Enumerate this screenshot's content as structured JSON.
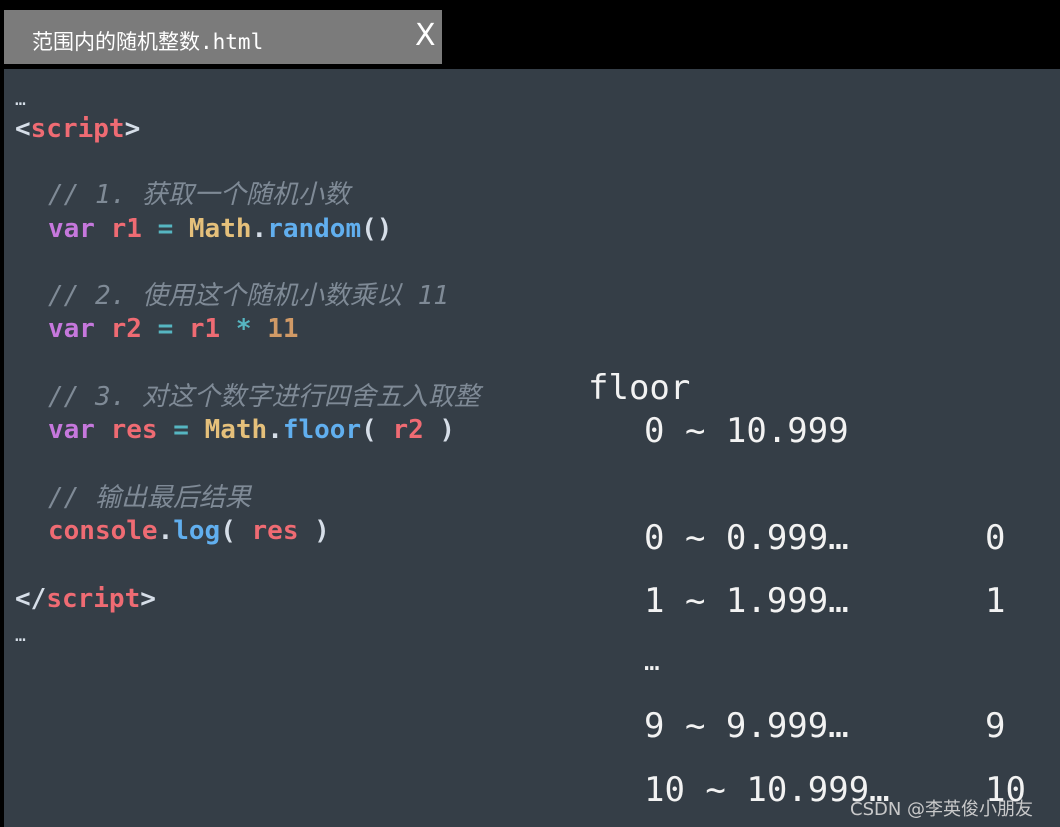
{
  "tab": {
    "title": "范围内的随机整数.html",
    "close_label": "X"
  },
  "code": {
    "ellipsis_top": "…",
    "open_tag_lt": "<",
    "open_tag_name": "script",
    "open_tag_gt": ">",
    "comment1": "// 1. 获取一个随机小数",
    "line1": {
      "kw": "var",
      "var": "r1",
      "eq": "=",
      "cls": "Math",
      "dot": ".",
      "fn": "random",
      "paren": "()"
    },
    "comment2": "// 2. 使用这个随机小数乘以 11",
    "line2": {
      "kw": "var",
      "var": "r2",
      "eq": "=",
      "ref": "r1",
      "op": "*",
      "num": "11"
    },
    "comment3": "// 3. 对这个数字进行四舍五入取整",
    "line3": {
      "kw": "var",
      "var": "res",
      "eq": "=",
      "cls": "Math",
      "dot": ".",
      "fn": "floor",
      "lparen": "(",
      "arg": "r2",
      "rparen": ")"
    },
    "comment4": "// 输出最后结果",
    "line4": {
      "obj": "console",
      "dot": ".",
      "fn": "log",
      "lparen": "(",
      "arg": "res",
      "rparen": ")"
    },
    "close_tag_lt": "</",
    "close_tag_name": "script",
    "close_tag_gt": ">",
    "ellipsis_bottom": "…"
  },
  "annotation": {
    "title": "floor",
    "range": "0 ~ 10.999",
    "rows": [
      {
        "range": "0 ~ 0.999…",
        "result": "0"
      },
      {
        "range": "1 ~ 1.999…",
        "result": "1"
      },
      {
        "range": "…",
        "result": ""
      },
      {
        "range": "9 ~ 9.999…",
        "result": "9"
      },
      {
        "range": "10 ~ 10.999…",
        "result": "10"
      }
    ]
  },
  "watermark": "CSDN @李英俊小朋友",
  "colors": {
    "background": "#353e47",
    "comment": "#7f8a96",
    "keyword": "#c678dd",
    "variable": "#ef6b73",
    "operator": "#56b6c2",
    "class": "#e5c07b",
    "function": "#61afef",
    "number": "#d19a66"
  }
}
